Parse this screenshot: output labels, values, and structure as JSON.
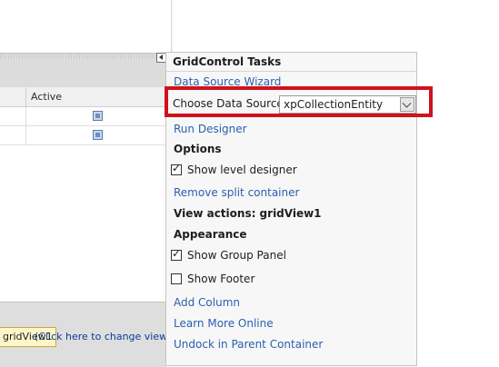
{
  "grid": {
    "column_active": "Active",
    "rows": [
      {
        "active": true
      },
      {
        "active": true
      }
    ],
    "view_badge": "gridView1",
    "view_hint": "(Click here to change view)"
  },
  "tasks": {
    "title": "GridControl Tasks",
    "data_source_wizard": "Data Source Wizard",
    "choose_data_source_label": "Choose Data Source",
    "choose_data_source_value": "xpCollectionEntity",
    "run_designer": "Run Designer",
    "options_heading": "Options",
    "show_level_designer": {
      "label": "Show level designer",
      "checked": true
    },
    "remove_split_container": "Remove split container",
    "view_actions_heading": "View actions: gridView1",
    "appearance_heading": "Appearance",
    "show_group_panel": {
      "label": "Show Group Panel",
      "checked": true
    },
    "show_footer": {
      "label": "Show Footer",
      "checked": false
    },
    "add_column": "Add Column",
    "learn_more_online": "Learn More Online",
    "undock": "Undock in Parent Container"
  },
  "colors": {
    "highlight": "#d0121b",
    "link": "#2b5fae"
  }
}
